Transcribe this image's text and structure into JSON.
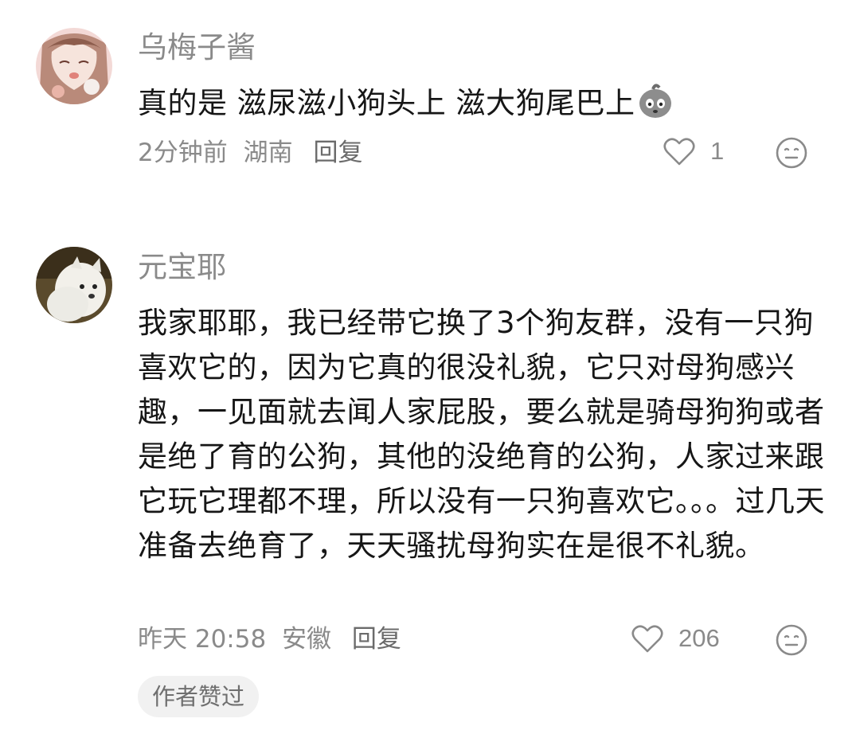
{
  "comments": [
    {
      "username": "乌梅子酱",
      "text": "真的是 滋尿滋小狗头上 滋大狗尾巴上",
      "emoji": "potato-face-emoji",
      "time": "2分钟前",
      "location": "湖南",
      "reply": "回复",
      "likes": "1"
    },
    {
      "username": "元宝耶",
      "text": "我家耶耶，我已经带它换了3个狗友群，没有一只狗喜欢它的，因为它真的很没礼貌，它只对母狗感兴趣，一见面就去闻人家屁股，要么就是骑母狗狗或者是绝了育的公狗，其他的没绝育的公狗，人家过来跟它玩它理都不理，所以没有一只狗喜欢它。。。过几天准备去绝育了，天天骚扰母狗实在是很不礼貌。",
      "time": "昨天 20:58",
      "location": "安徽",
      "reply": "回复",
      "likes": "206",
      "badge": "作者赞过"
    }
  ],
  "icons": {
    "like": "heart-outline-icon",
    "dislike": "meh-face-icon"
  },
  "colors": {
    "text": "#161616",
    "muted": "#8a8a8a",
    "badge_bg": "#f1f1f1"
  }
}
